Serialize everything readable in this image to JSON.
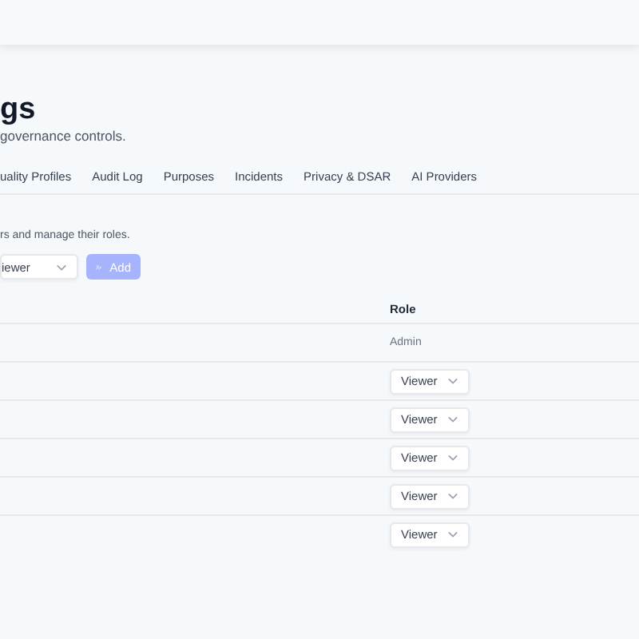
{
  "page": {
    "title": "gs",
    "subtitle": "governance controls."
  },
  "tabs": [
    {
      "label": "uality Profiles"
    },
    {
      "label": "Audit Log"
    },
    {
      "label": "Purposes"
    },
    {
      "label": "Incidents"
    },
    {
      "label": "Privacy & DSAR"
    },
    {
      "label": "AI Providers"
    }
  ],
  "members": {
    "description": "rs and manage their roles.",
    "role_select": "iewer",
    "add_button": {
      "label": "Add",
      "disabled": true
    }
  },
  "table": {
    "columns": [
      "Role"
    ],
    "rows": [
      {
        "kind": "text",
        "role": "Admin"
      },
      {
        "kind": "select",
        "role": "Viewer"
      },
      {
        "kind": "select",
        "role": "Viewer"
      },
      {
        "kind": "select",
        "role": "Viewer"
      },
      {
        "kind": "select",
        "role": "Viewer"
      },
      {
        "kind": "select",
        "role": "Viewer"
      }
    ]
  }
}
